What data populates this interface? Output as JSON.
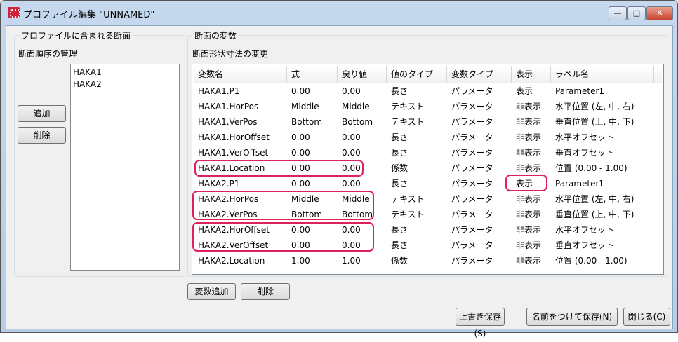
{
  "window": {
    "title": "プロファイル編集 \"UNNAMED\"",
    "minimize": "—",
    "maximize": "□",
    "close": "✕"
  },
  "left_group": {
    "title": "プロファイルに含まれる断面",
    "subtitle": "断面順序の管理",
    "sections": [
      "HAKA1",
      "HAKA2"
    ],
    "add_button": "追加",
    "delete_button": "削除"
  },
  "right_group": {
    "title": "断面の変数",
    "subtitle": "断面形状寸法の変更",
    "columns": [
      "変数名",
      "式",
      "戻り値",
      "値のタイプ",
      "変数タイプ",
      "表示",
      "ラベル名"
    ],
    "rows": [
      [
        "HAKA1.P1",
        "0.00",
        "0.00",
        "長さ",
        "パラメータ",
        "表示",
        "Parameter1"
      ],
      [
        "HAKA1.HorPos",
        "Middle",
        "Middle",
        "テキスト",
        "パラメータ",
        "非表示",
        "水平位置 (左, 中, 右)"
      ],
      [
        "HAKA1.VerPos",
        "Bottom",
        "Bottom",
        "テキスト",
        "パラメータ",
        "非表示",
        "垂直位置 (上, 中, 下)"
      ],
      [
        "HAKA1.HorOffset",
        "0.00",
        "0.00",
        "長さ",
        "パラメータ",
        "非表示",
        "水平オフセット"
      ],
      [
        "HAKA1.VerOffset",
        "0.00",
        "0.00",
        "長さ",
        "パラメータ",
        "非表示",
        "垂直オフセット"
      ],
      [
        "HAKA1.Location",
        "0.00",
        "0.00",
        "係数",
        "パラメータ",
        "非表示",
        "位置 (0.00 - 1.00)"
      ],
      [
        "HAKA2.P1",
        "0.00",
        "0.00",
        "長さ",
        "パラメータ",
        "表示",
        "Parameter1"
      ],
      [
        "HAKA2.HorPos",
        "Middle",
        "Middle",
        "テキスト",
        "パラメータ",
        "非表示",
        "水平位置 (左, 中, 右)"
      ],
      [
        "HAKA2.VerPos",
        "Bottom",
        "Bottom",
        "テキスト",
        "パラメータ",
        "非表示",
        "垂直位置 (上, 中, 下)"
      ],
      [
        "HAKA2.HorOffset",
        "0.00",
        "0.00",
        "長さ",
        "パラメータ",
        "非表示",
        "水平オフセット"
      ],
      [
        "HAKA2.VerOffset",
        "0.00",
        "0.00",
        "長さ",
        "パラメータ",
        "非表示",
        "垂直オフセット"
      ],
      [
        "HAKA2.Location",
        "1.00",
        "1.00",
        "係数",
        "パラメータ",
        "非表示",
        "位置 (0.00 - 1.00)"
      ]
    ],
    "add_variable_button": "変数追加",
    "delete_button": "削除"
  },
  "footer": {
    "overwrite_save": "上書き保存(S)",
    "save_as": "名前をつけて保存(N)",
    "close": "閉じる(C)"
  },
  "colors": {
    "highlight": "#e0205a"
  }
}
